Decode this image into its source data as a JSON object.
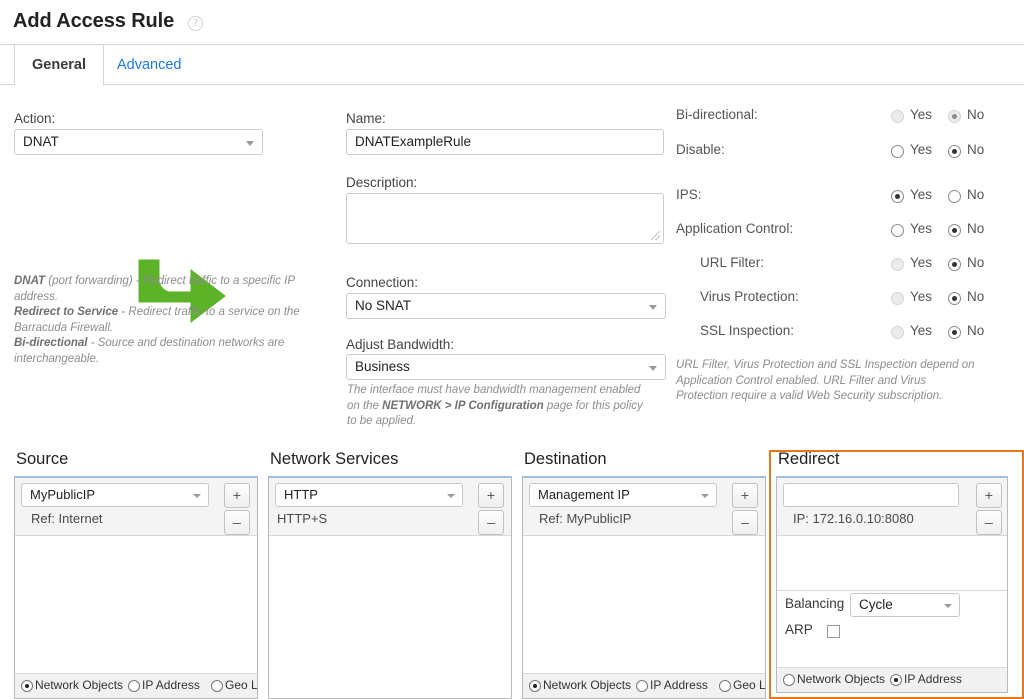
{
  "header": {
    "title": "Add Access Rule",
    "help_icon": "question-circle-icon"
  },
  "tabs": [
    {
      "label": "General",
      "active": true
    },
    {
      "label": "Advanced",
      "active": false
    }
  ],
  "general": {
    "action": {
      "label": "Action:",
      "value": "DNAT",
      "icon": "green-curved-right-arrow-icon",
      "note_lines": [
        {
          "bold": "DNAT",
          "rest": " (port forwarding) - Redirect traffic to a specific IP address."
        },
        {
          "bold": "Redirect to Service",
          "rest": " - Redirect traffic to a service on the Barracuda Firewall."
        },
        {
          "bold": "Bi-directional",
          "rest": " - Source and destination networks are interchangeable."
        }
      ]
    },
    "name": {
      "label": "Name:",
      "value": "DNATExampleRule"
    },
    "description": {
      "label": "Description:",
      "value": ""
    },
    "connection": {
      "label": "Connection:",
      "value": "No SNAT"
    },
    "adjust_bandwidth": {
      "label": "Adjust Bandwidth:",
      "value": "Business",
      "note": "The interface must have bandwidth management enabled on the NETWORK > IP Configuration page for this policy to be applied.",
      "note_parts": {
        "p1": "The interface must have bandwidth management enabled on the ",
        "b1": "NETWORK > IP Configuration",
        "p2": " page for this policy to be applied."
      }
    },
    "yes_label": "Yes",
    "no_label": "No",
    "options": [
      {
        "label": "Bi-directional:",
        "selected": "No",
        "disabled": true,
        "indent": false
      },
      {
        "label": "Disable:",
        "selected": "No",
        "disabled": false,
        "indent": false
      },
      {
        "label": "IPS:",
        "selected": "Yes",
        "disabled": false,
        "indent": false
      },
      {
        "label": "Application Control:",
        "selected": "No",
        "disabled": false,
        "indent": false
      },
      {
        "label": "URL Filter:",
        "selected": "No",
        "disabled": true,
        "indent": true
      },
      {
        "label": "Virus Protection:",
        "selected": "No",
        "disabled": true,
        "indent": true
      },
      {
        "label": "SSL Inspection:",
        "selected": "No",
        "disabled": true,
        "indent": true
      }
    ],
    "options_note": "URL Filter, Virus Protection and SSL Inspection depend on Application Control enabled. URL Filter and Virus Protection require a valid Web Security subscription."
  },
  "panels": {
    "source": {
      "title": "Source",
      "selector_value": "MyPublicIP",
      "entries": [
        "Ref: Internet"
      ],
      "add_label": "+",
      "remove_label": "–",
      "options": [
        {
          "label": "Network Objects",
          "selected": true
        },
        {
          "label": "IP Address",
          "selected": false
        },
        {
          "label": "Geo Loc",
          "selected": false
        }
      ]
    },
    "network_services": {
      "title": "Network Services",
      "selector_value": "HTTP",
      "entries": [
        "HTTP+S"
      ],
      "add_label": "+",
      "remove_label": "–",
      "options": []
    },
    "destination": {
      "title": "Destination",
      "selector_value": "Management IP",
      "entries": [
        "Ref: MyPublicIP"
      ],
      "add_label": "+",
      "remove_label": "–",
      "options": [
        {
          "label": "Network Objects",
          "selected": true
        },
        {
          "label": "IP Address",
          "selected": false
        },
        {
          "label": "Geo Loc",
          "selected": false
        }
      ]
    },
    "redirect": {
      "title": "Redirect",
      "input_value": "",
      "entries": [
        "IP: 172.16.0.10:8080"
      ],
      "add_label": "+",
      "remove_label": "–",
      "balancing_label": "Balancing",
      "balancing_value": "Cycle",
      "arp_label": "ARP",
      "arp_checked": false,
      "options": [
        {
          "label": "Network Objects",
          "selected": false
        },
        {
          "label": "IP Address",
          "selected": true
        }
      ],
      "highlight_color": "#e8761a"
    }
  }
}
